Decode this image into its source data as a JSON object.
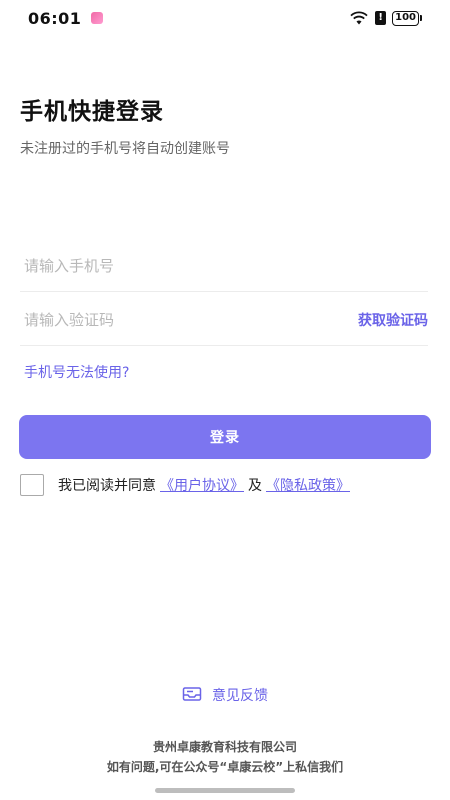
{
  "status_bar": {
    "time": "06:01",
    "battery": "100",
    "alert_glyph": "!"
  },
  "header": {
    "title": "手机快捷登录",
    "subtitle": "未注册过的手机号将自动创建账号"
  },
  "form": {
    "phone_placeholder": "请输入手机号",
    "code_placeholder": "请输入验证码",
    "get_code_label": "获取验证码",
    "phone_issue_link": "手机号无法使用?",
    "login_label": "登录"
  },
  "agreement": {
    "checked": false,
    "prefix": "我已阅读并同意",
    "user_agreement": "《用户协议》",
    "conjunction": "及",
    "privacy_policy": "《隐私政策》"
  },
  "feedback": {
    "label": "意见反馈",
    "icon": "feedback-icon"
  },
  "footer": {
    "company": "贵州卓康教育科技有限公司",
    "contact": "如有问题,可在公众号“卓康云校”上私信我们"
  },
  "colors": {
    "accent": "#6a63e8",
    "button": "#7c75f0"
  }
}
